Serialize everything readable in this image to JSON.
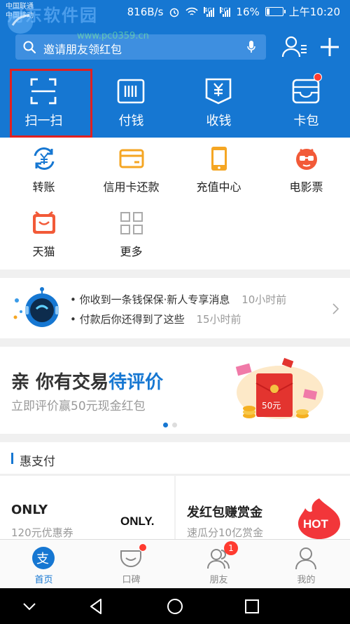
{
  "status_bar": {
    "carrier_line1": "中国联通",
    "carrier_line2": "中国移动",
    "net_speed": "816B/s",
    "signal1_type": "4G",
    "signal2_type": "2G",
    "battery_text": "16%",
    "battery_level": 0.16,
    "time": "上午10:20"
  },
  "watermark": {
    "text": "河东软件园",
    "url": "www.pc0359.cn"
  },
  "header": {
    "search_placeholder": "邀请朋友领红包",
    "quick_actions": [
      {
        "label": "扫一扫",
        "icon": "scan-icon"
      },
      {
        "label": "付钱",
        "icon": "barcode-icon"
      },
      {
        "label": "收钱",
        "icon": "yuan-receipt-icon"
      },
      {
        "label": "卡包",
        "icon": "card-wallet-icon"
      }
    ]
  },
  "grid": {
    "items": [
      {
        "label": "转账",
        "icon": "transfer-icon",
        "color": "#1677d2"
      },
      {
        "label": "信用卡还款",
        "icon": "credit-card-icon",
        "color": "#f5a623"
      },
      {
        "label": "充值中心",
        "icon": "phone-recharge-icon",
        "color": "#f5a623"
      },
      {
        "label": "电影票",
        "icon": "movie-ticket-icon",
        "color": "#f25a38"
      },
      {
        "label": "天猫",
        "icon": "tmall-icon",
        "color": "#f25a38"
      },
      {
        "label": "更多",
        "icon": "more-grid-icon",
        "color": "#999999"
      }
    ]
  },
  "messages": {
    "items": [
      {
        "text": "你收到一条钱保保·新人专享消息",
        "time": "10小时前"
      },
      {
        "text": "付款后你还得到了这些",
        "time": "15小时前"
      }
    ]
  },
  "banner": {
    "title_prefix": "亲 你有交易",
    "title_highlight": "待评价",
    "subtitle": "立即评价赢50元现金红包",
    "envelope_amount": "50元",
    "page_count": 2,
    "active_page": 1
  },
  "hui": {
    "section_title": "惠支付",
    "promos": [
      {
        "name": "ONLY",
        "desc": "120元优惠券",
        "logo": "ONLY."
      },
      {
        "name": "发红包赚赏金",
        "desc": "速瓜分10亿赏金",
        "logo": "HOT"
      }
    ]
  },
  "tabbar": {
    "tabs": [
      {
        "label": "首页",
        "icon": "home-alipay-icon",
        "active": true
      },
      {
        "label": "口碑",
        "icon": "koubei-icon"
      },
      {
        "label": "朋友",
        "icon": "friends-icon",
        "badge": "1"
      },
      {
        "label": "我的",
        "icon": "profile-icon"
      }
    ]
  },
  "colors": {
    "primary": "#1677d2",
    "accent_red": "#ff3b30",
    "orange": "#f5a623"
  }
}
